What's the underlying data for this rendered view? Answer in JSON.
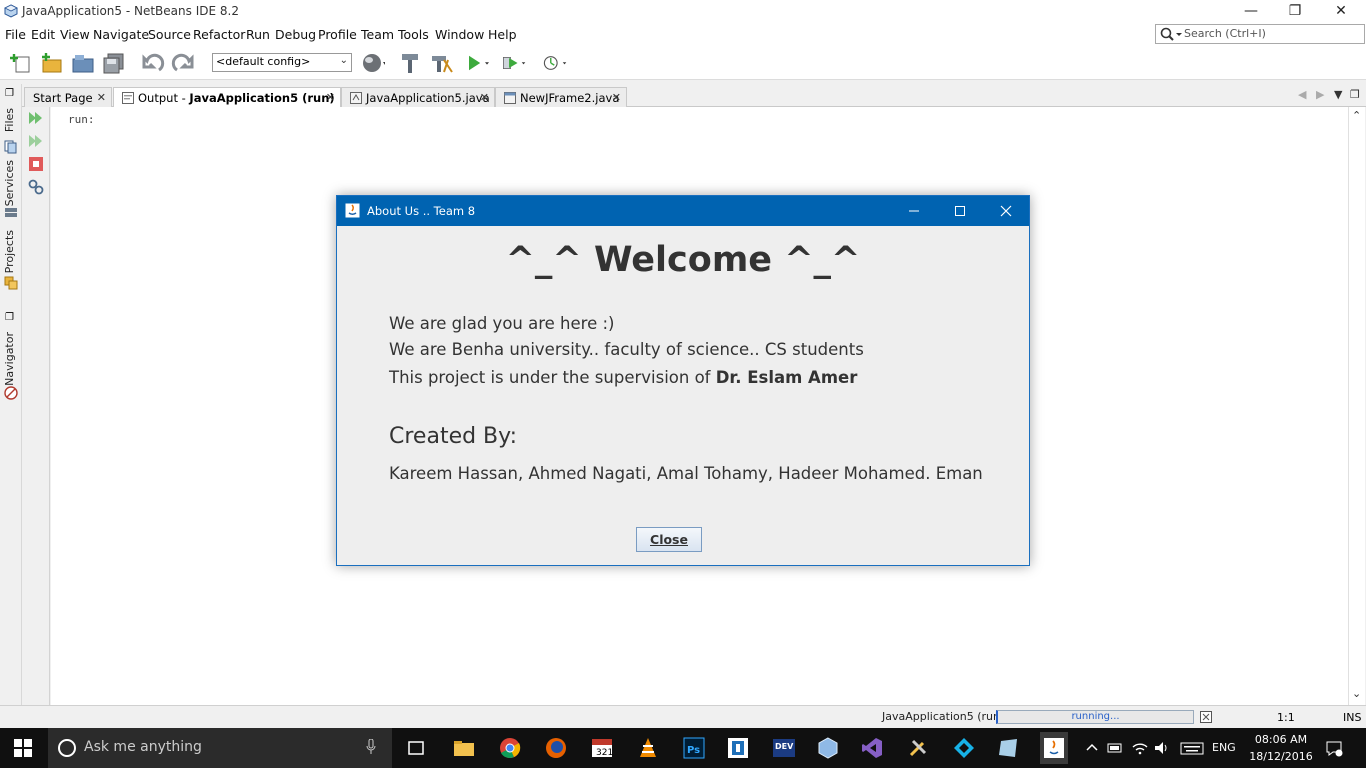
{
  "window": {
    "title": "JavaApplication5 - NetBeans IDE 8.2",
    "icons": [
      "netbeans-icon",
      "minimize-icon",
      "restore-icon",
      "close-icon"
    ]
  },
  "menu": [
    "File",
    "Edit",
    "View",
    "Navigate",
    "Source",
    "Refactor",
    "Run",
    "Debug",
    "Profile",
    "Team",
    "Tools",
    "Window",
    "Help"
  ],
  "search": {
    "placeholder": "Search (Ctrl+I)"
  },
  "toolbar": {
    "config": "<default config>",
    "icons": [
      "new-file-icon",
      "new-project-icon",
      "open-project-icon",
      "save-all-icon",
      "undo-icon",
      "redo-icon",
      "globe-icon",
      "build-icon",
      "clean-build-icon",
      "run-icon",
      "debug-icon",
      "profile-icon"
    ]
  },
  "side_tabs": [
    "Files",
    "Services",
    "Projects",
    "Navigator"
  ],
  "tabs": [
    {
      "label": "Start Page"
    },
    {
      "label_prefix": "Output - ",
      "label_bold": "JavaApplication5 (run)"
    },
    {
      "label": "JavaApplication5.java"
    },
    {
      "label": "NewJFrame2.java"
    }
  ],
  "output": {
    "text": "run:"
  },
  "status": {
    "project": "JavaApplication5 (run)",
    "progress_text": "running...",
    "position": "1:1",
    "mode": "INS"
  },
  "dialog": {
    "title": "About Us .. Team 8",
    "heading": "^_^ Welcome ^_^",
    "line1": "We are glad you are here :)",
    "line2": "We are Benha university.. faculty of science.. CS students",
    "line3_prefix": "This project is under the supervision of ",
    "line3_bold": "Dr. Eslam Amer",
    "created_by": "Created By:",
    "names": "Kareem Hassan, Ahmed Nagati, Amal Tohamy, Hadeer Mohamed. Eman",
    "close_label": "Close"
  },
  "taskbar": {
    "search_placeholder": "Ask me anything",
    "apps": [
      "task-view-icon",
      "file-explorer-icon",
      "chrome-icon",
      "firefox-icon",
      "calendar-app-icon",
      "vlc-icon",
      "photoshop-icon",
      "app-icon",
      "dev-cpp-icon",
      "virtualbox-icon",
      "visual-studio-icon",
      "tools-icon",
      "kodi-icon",
      "app-shortcut-icon",
      "java-icon"
    ],
    "language": "ENG",
    "time": "08:06 AM",
    "date": "18/12/2016"
  }
}
